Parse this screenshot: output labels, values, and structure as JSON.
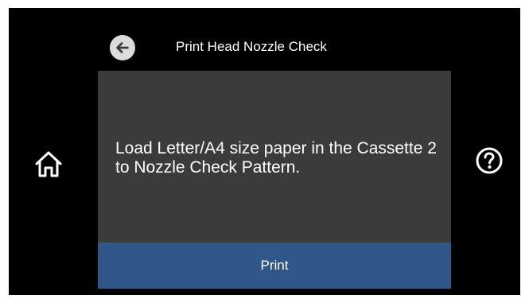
{
  "header": {
    "title": "Print Head Nozzle Check",
    "back_icon": "back-arrow-icon"
  },
  "dialog": {
    "message": "Load Letter/A4 size paper in the Cassette 2 to Nozzle Check Pattern."
  },
  "actions": {
    "print_label": "Print"
  },
  "side_icons": {
    "home": "home-icon",
    "help": "help-icon"
  },
  "colors": {
    "screen_background": "#000000",
    "dialog_background": "#3b3b3b",
    "button_background": "#2f5788",
    "text": "#ffffff"
  }
}
